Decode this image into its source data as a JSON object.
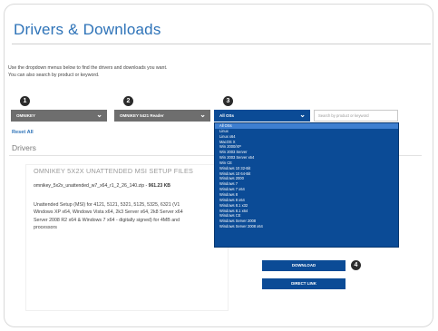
{
  "header": {
    "title": "Drivers & Downloads"
  },
  "intro": {
    "line1": "Use the dropdown menus below to find the drivers and downloads you want.",
    "line2": "You can also search by product or keyword."
  },
  "steps": [
    "1",
    "2",
    "3",
    "4"
  ],
  "selectors": {
    "family": {
      "value": "OMNIKEY"
    },
    "product": {
      "value": "OMNIKEY 5421 Reader"
    },
    "os": {
      "value": "All OSs"
    }
  },
  "search": {
    "placeholder": "Search by product or keyword"
  },
  "reset_label": "Reset All",
  "section_label": "Drivers",
  "file": {
    "title": "OMNIKEY 5X2X UNATTENDED MSI SETUP FILES",
    "name": "omnikey_5x2x_unattended_w7_x64_r1_2_26_140.zip -",
    "size": "961.23 KB",
    "desc_lines": [
      "Unattended Setup (MSI) for 4121, 5121, 5321, 5125, 5325, 6321 (V1",
      "Windows XP x64, Windows Vista x64, 2k3 Server x64, 2k8 Server x64",
      "Server 2008 R2 x64 & Windows 7 x64 - digitally signed) for 4MB and",
      "processors"
    ]
  },
  "os_options": [
    "All OSs",
    "Linux",
    "Linux x64",
    "MacOS X",
    "Win 2000/XP",
    "Win 2003 Server",
    "Win 2003 Server x64",
    "Win CE",
    "Windows 10 32-Bit",
    "Windows 10 64-Bit",
    "Windows 2000",
    "Windows 7",
    "Windows 7 x64",
    "Windows 8",
    "Windows 8 x64",
    "Windows 8.1 x32",
    "Windows 8.1 x64",
    "Windows CE",
    "Windows Server 2008",
    "Windows Server 2008 x64"
  ],
  "buttons": {
    "download": "DOWNLOAD",
    "direct_link": "DIRECT LINK"
  },
  "icons": {
    "chevron": "chevron-down-icon"
  },
  "colors": {
    "accent": "#2e73b8",
    "navy": "#0b4b96",
    "gray_select": "#6e6e6e"
  }
}
